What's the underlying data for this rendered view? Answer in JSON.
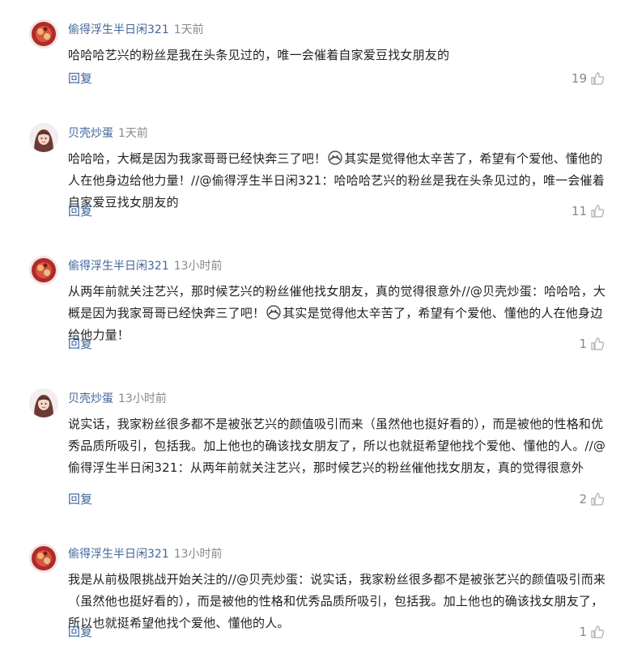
{
  "comments": [
    {
      "username": "偷得浮生半日闲321",
      "time": "1天前",
      "avatar": "user-1-avatar",
      "content_parts": [
        "哈哈哈艺兴的粉丝是我在头条见过的，唯一会催着自家爱豆找女朋友的"
      ],
      "reply_label": "回复",
      "likes": "19"
    },
    {
      "username": "贝壳炒蛋",
      "time": "1天前",
      "avatar": "user-2-avatar",
      "content_parts": [
        "哈哈哈，大概是因为我家哥哥已经快奔三了吧！",
        "其实是觉得他太辛苦了，希望有个爱他、懂他的人在他身边给他力量！//@偷得浮生半日闲321：哈哈哈艺兴的粉丝是我在头条见过的，唯一会催着自家爱豆找女朋友的"
      ],
      "reply_label": "回复",
      "likes": "11"
    },
    {
      "username": "偷得浮生半日闲321",
      "time": "13小时前",
      "avatar": "user-1-avatar",
      "content_parts": [
        "从两年前就关注艺兴，那时候艺兴的粉丝催他找女朋友，真的觉得很意外//@贝壳炒蛋：哈哈哈，大概是因为我家哥哥已经快奔三了吧！",
        "其实是觉得他太辛苦了，希望有个爱他、懂他的人在他身边给他力量！"
      ],
      "reply_label": "回复",
      "likes": "1"
    },
    {
      "username": "贝壳炒蛋",
      "time": "13小时前",
      "avatar": "user-2-avatar",
      "content_parts": [
        "说实话，我家粉丝很多都不是被张艺兴的颜值吸引而来（虽然他也挺好看的），而是被他的性格和优秀品质所吸引，包括我。加上他也的确该找女朋友了，所以也就挺希望他找个爱他、懂他的人。//@偷得浮生半日闲321：从两年前就关注艺兴，那时候艺兴的粉丝催他找女朋友，真的觉得很意外"
      ],
      "reply_label": "回复",
      "likes": "2"
    },
    {
      "username": "偷得浮生半日闲321",
      "time": "13小时前",
      "avatar": "user-1-avatar",
      "content_parts": [
        "我是从前极限挑战开始关注的//@贝壳炒蛋：说实话，我家粉丝很多都不是被张艺兴的颜值吸引而来（虽然他也挺好看的），而是被他的性格和优秀品质所吸引，包括我。加上他也的确该找女朋友了，所以也就挺希望他找个爱他、懂他的人。"
      ],
      "reply_label": "回复",
      "likes": "1"
    }
  ],
  "colors": {
    "username": "#406599",
    "time": "#888888",
    "text": "#222222",
    "reply": "#406599",
    "like_icon": "#b8b8b8"
  },
  "icons": {
    "emoji": "cover-face-emoji",
    "like": "thumbs-up-icon"
  }
}
